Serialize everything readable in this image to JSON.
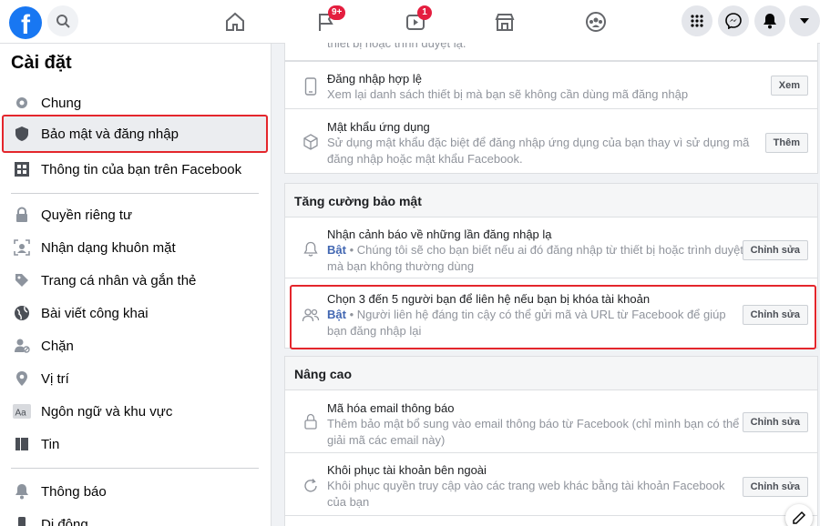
{
  "topbar": {
    "logo_letter": "f",
    "badges": {
      "flag": "9+",
      "video": "1"
    }
  },
  "sidebar": {
    "title": "Cài đặt",
    "items": [
      {
        "label": "Chung",
        "icon": "gear-icon"
      },
      {
        "label": "Bảo mật và đăng nhập",
        "icon": "shield-icon"
      },
      {
        "label": "Thông tin của bạn trên Facebook",
        "icon": "grid-icon"
      },
      {
        "label": "Quyền riêng tư",
        "icon": "lock-icon"
      },
      {
        "label": "Nhận dạng khuôn mặt",
        "icon": "face-icon"
      },
      {
        "label": "Trang cá nhân và gắn thẻ",
        "icon": "tag-icon"
      },
      {
        "label": "Bài viết công khai",
        "icon": "globe-icon"
      },
      {
        "label": "Chặn",
        "icon": "block-user-icon"
      },
      {
        "label": "Vị trí",
        "icon": "location-pin-icon"
      },
      {
        "label": "Ngôn ngữ và khu vực",
        "icon": "language-icon"
      },
      {
        "label": "Tin",
        "icon": "book-icon"
      },
      {
        "label": "Thông báo",
        "icon": "bell-icon"
      },
      {
        "label": "Di động",
        "icon": "mobile-icon"
      }
    ]
  },
  "main": {
    "top_cut_text": "thiết bị hoặc trình duyệt lạ.",
    "rows_top": [
      {
        "title": "Đăng nhập hợp lệ",
        "desc": "Xem lại danh sách thiết bị mà bạn sẽ không cần dùng mã đăng nhập",
        "button": "Xem",
        "icon": "phone-icon"
      },
      {
        "title": "Mật khẩu ứng dụng",
        "desc": "Sử dụng mật khẩu đặc biệt để đăng nhập ứng dụng của bạn thay vì sử dụng mã đăng nhập hoặc mật khẩu Facebook.",
        "button": "Thêm",
        "icon": "cube-icon"
      }
    ],
    "section_security": "Tăng cường bảo mật",
    "rows_security": [
      {
        "title": "Nhận cảnh báo về những lần đăng nhập lạ",
        "on": "Bật",
        "desc": " • Chúng tôi sẽ cho bạn biết nếu ai đó đăng nhập từ thiết bị hoặc trình duyệt mà bạn không thường dùng",
        "button": "Chỉnh sửa",
        "icon": "bell-outline-icon"
      },
      {
        "title": "Chọn 3 đến 5 người bạn để liên hệ nếu bạn bị khóa tài khoản",
        "on": "Bật",
        "desc": " • Người liên hệ đáng tin cậy có thể gửi mã và URL từ Facebook để giúp bạn đăng nhập lại",
        "button": "Chỉnh sửa",
        "icon": "people-icon"
      }
    ],
    "section_advanced": "Nâng cao",
    "rows_advanced": [
      {
        "title": "Mã hóa email thông báo",
        "desc": "Thêm bảo mật bổ sung vào email thông báo từ Facebook (chỉ mình bạn có thể giải mã các email này)",
        "button": "Chỉnh sửa",
        "icon": "padlock-icon"
      },
      {
        "title": "Khôi phục tài khoản bên ngoài",
        "desc": "Khôi phục quyền truy cập vào các trang web khác bằng tài khoản Facebook của bạn",
        "button": "Chỉnh sửa",
        "icon": "refresh-icon"
      }
    ]
  },
  "colors": {
    "accent": "#1877f2",
    "highlight": "#e4262c",
    "on_text": "#4267b2"
  }
}
